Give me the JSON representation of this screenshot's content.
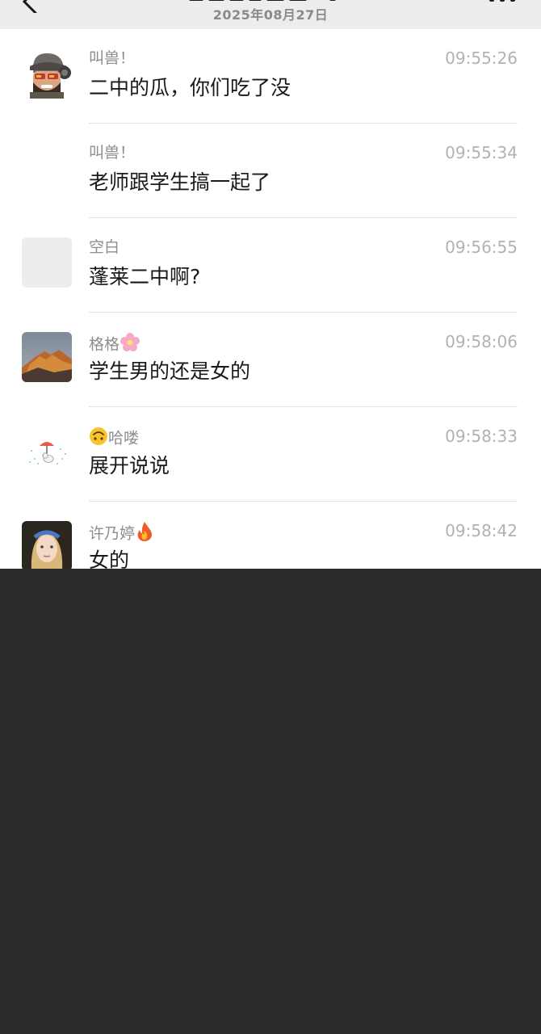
{
  "header": {
    "date": "2025年08月27日",
    "back_icon": "chevron-left-icon",
    "more_icon": "more-dots-icon"
  },
  "messages": [
    {
      "sender": "叫兽！",
      "time": "09:55:26",
      "text": "二中的瓜，你们吃了没",
      "avatar": "soldier-cartoon-avatar",
      "show_avatar": true
    },
    {
      "sender": "叫兽！",
      "time": "09:55:34",
      "text": "老师跟学生搞一起了",
      "avatar": "soldier-cartoon-avatar",
      "show_avatar": false
    },
    {
      "sender": "空白",
      "time": "09:56:55",
      "text": "蓬莱二中啊?",
      "avatar": "blank-gray-avatar",
      "show_avatar": true
    },
    {
      "sender": "格格",
      "sender_emoji": "cherry-blossom-icon",
      "time": "09:58:06",
      "text": "学生男的还是女的",
      "avatar": "mountain-sunset-avatar",
      "show_avatar": true
    },
    {
      "sender": "哈喽",
      "sender_emoji_prefix": "upside-down-face-icon",
      "time": "09:58:33",
      "text": "展开说说",
      "avatar": "duck-umbrella-avatar",
      "show_avatar": true
    },
    {
      "sender": "许乃婷",
      "sender_emoji": "fire-icon",
      "time": "09:58:42",
      "text": "女的",
      "avatar": "girl-portrait-avatar",
      "show_avatar": true
    }
  ],
  "colors": {
    "page_bg": "#2b2b2b",
    "panel_bg": "#ffffff",
    "header_bg": "#ededed",
    "sender_color": "#8d8d8d",
    "time_color": "#b2b2b2",
    "text_color": "#1a1a1a"
  }
}
